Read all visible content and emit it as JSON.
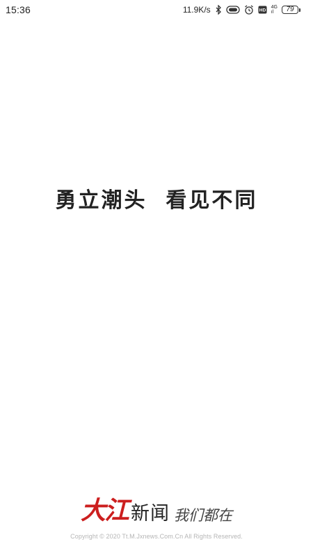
{
  "status_bar": {
    "time": "15:36",
    "net_speed": "11.9K/s",
    "network_badge_top": "4G",
    "network_badge_bottom": "ıl",
    "hd_label": "HD",
    "battery_level": "79"
  },
  "splash": {
    "slogan": "勇立潮头  看见不同"
  },
  "brand": {
    "logo_text": "大江",
    "name": "新闻",
    "tagline": "我们都在",
    "logo_color": "#cc1f1f"
  },
  "footer": {
    "copyright": "Copyright © 2020 Tt.M.Jxnews.Com.Cn All Rights Reserved."
  },
  "icons": [
    "bluetooth-icon",
    "toggle-icon",
    "alarm-icon",
    "hd-icon",
    "signal-icon",
    "battery-icon"
  ]
}
